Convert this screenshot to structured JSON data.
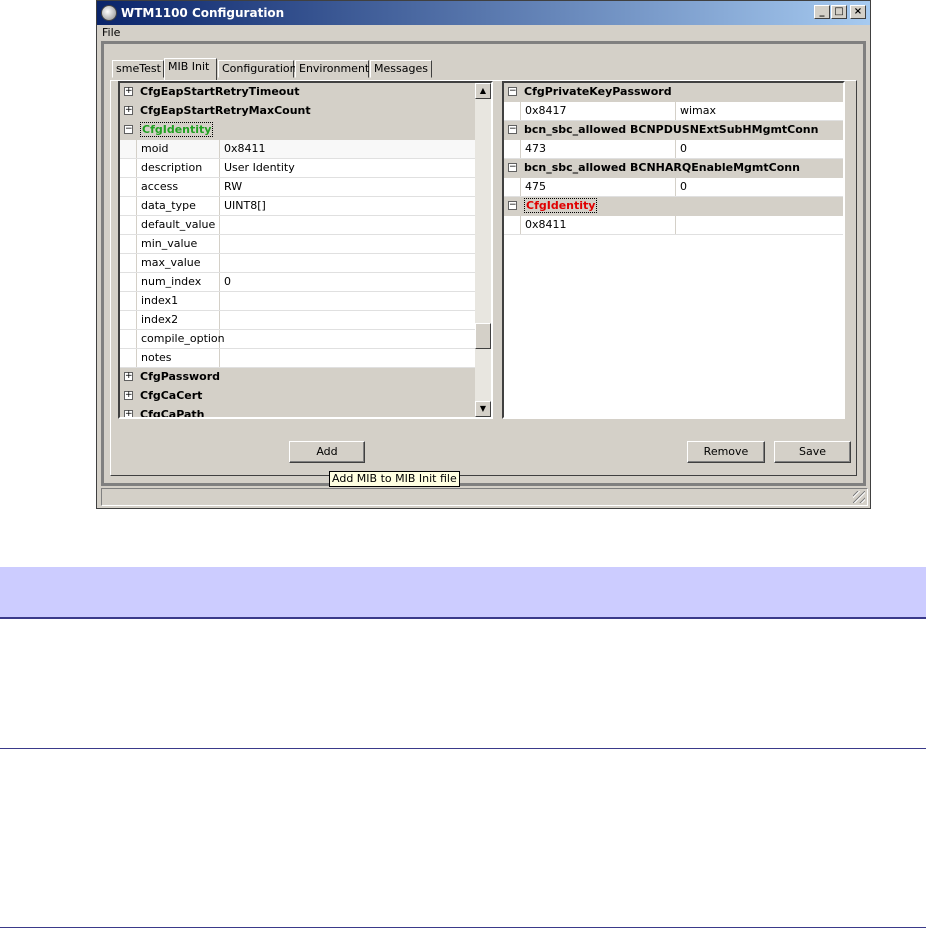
{
  "window": {
    "title": "WTM1100 Configuration",
    "controls": {
      "minimize": "_",
      "maximize": "□",
      "close": "×"
    }
  },
  "menu": {
    "file": "File"
  },
  "tabs": [
    {
      "label": "smeTest",
      "active": false
    },
    {
      "label": "MIB Init",
      "active": true
    },
    {
      "label": "Configuration",
      "active": false
    },
    {
      "label": "Environment",
      "active": false
    },
    {
      "label": "Messages",
      "active": false
    }
  ],
  "left_tree": {
    "groups_top": [
      {
        "toggle": "+",
        "name": "CfgEapStartRetryTimeout"
      },
      {
        "toggle": "+",
        "name": "CfgEapStartRetryMaxCount"
      }
    ],
    "expanded": {
      "toggle": "−",
      "name": "CfgIdentity",
      "color": "#21a121"
    },
    "properties": [
      {
        "key": "moid",
        "value": "0x8411"
      },
      {
        "key": "description",
        "value": "User Identity"
      },
      {
        "key": "access",
        "value": "RW"
      },
      {
        "key": "data_type",
        "value": "UINT8[]"
      },
      {
        "key": "default_value",
        "value": ""
      },
      {
        "key": "min_value",
        "value": ""
      },
      {
        "key": "max_value",
        "value": ""
      },
      {
        "key": "num_index",
        "value": "0"
      },
      {
        "key": "index1",
        "value": ""
      },
      {
        "key": "index2",
        "value": ""
      },
      {
        "key": "compile_option",
        "value": ""
      },
      {
        "key": "notes",
        "value": ""
      }
    ],
    "groups_bottom": [
      {
        "toggle": "+",
        "name": "CfgPassword"
      },
      {
        "toggle": "+",
        "name": "CfgCaCert"
      },
      {
        "toggle": "+",
        "name": "CfgCaPath"
      }
    ]
  },
  "right_tree": [
    {
      "toggle": "−",
      "name": "CfgPrivateKeyPassword",
      "key": "0x8417",
      "value": "wimax"
    },
    {
      "toggle": "−",
      "name": "bcn_sbc_allowed BCNPDUSNExtSubHMgmtConn",
      "key": "473",
      "value": "0"
    },
    {
      "toggle": "−",
      "name": "bcn_sbc_allowed BCNHARQEnableMgmtConn",
      "key": "475",
      "value": "0"
    },
    {
      "toggle": "−",
      "name": "CfgIdentity",
      "key": "0x8411",
      "value": "",
      "color": "#e00000"
    }
  ],
  "buttons": {
    "add": "Add",
    "remove": "Remove",
    "save": "Save"
  },
  "tooltip": "Add MIB to MIB Init file"
}
